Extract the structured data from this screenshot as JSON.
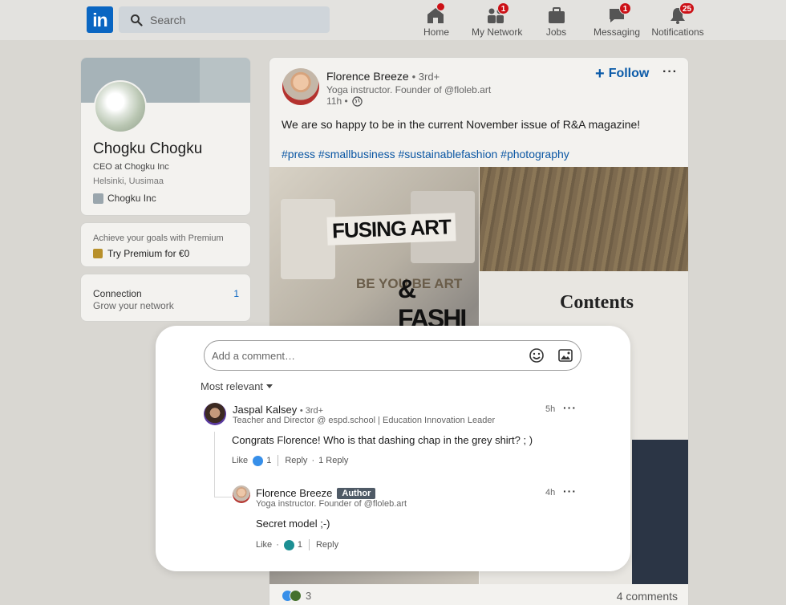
{
  "nav": {
    "logo": "in",
    "search_placeholder": "Search",
    "items": [
      {
        "label": "Home",
        "badge": null,
        "dot": true
      },
      {
        "label": "My Network",
        "badge": "1"
      },
      {
        "label": "Jobs",
        "badge": null
      },
      {
        "label": "Messaging",
        "badge": "1"
      },
      {
        "label": "Notifications",
        "badge": "25"
      }
    ]
  },
  "profile": {
    "name": "Chogku Chogku",
    "title": "CEO at Chogku Inc",
    "location": "Helsinki, Uusimaa",
    "company": "Chogku Inc"
  },
  "premium": {
    "tagline": "Achieve your goals with Premium",
    "cta": "Try Premium for €0"
  },
  "connections": {
    "label": "Connection",
    "sub": "Grow your network",
    "count": "1"
  },
  "post": {
    "author": "Florence Breeze",
    "degree": "• 3rd+",
    "headline": "Yoga instructor. Founder of @floleb.art",
    "time": "11h •",
    "follow_label": "Follow",
    "text": "We are so happy to be in the current November issue of R&A magazine!",
    "hashtags": "#press #smallbusiness #sustainablefashion #photography",
    "image_left": {
      "headline1": "FUSING ART",
      "headline2": "& FASHI",
      "side": "BE YOU BE ART"
    },
    "image_right": {
      "title": "Contents"
    },
    "reactions_count": "3",
    "comments_count": "4 comments"
  },
  "comments": {
    "input_placeholder": "Add a comment…",
    "sort_label": "Most relevant",
    "items": [
      {
        "name": "Jaspal Kalsey",
        "degree": "• 3rd+",
        "headline": "Teacher and Director @ espd.school | Education Innovation Leader",
        "time": "5h",
        "text": "Congrats Florence! Who is that dashing chap in the grey shirt? ; )",
        "like_label": "Like",
        "reaction_count": "1",
        "reply_label": "Reply",
        "replies": "1 Reply"
      },
      {
        "name": "Florence Breeze",
        "badge": "Author",
        "headline": "Yoga instructor. Founder of @floleb.art",
        "time": "4h",
        "text": "Secret model ;-)",
        "like_label": "Like",
        "reaction_count": "1",
        "reply_label": "Reply"
      }
    ]
  },
  "colors": {
    "brand": "#0a66c2",
    "badge": "#cc1016",
    "link": "#0a56a3"
  }
}
